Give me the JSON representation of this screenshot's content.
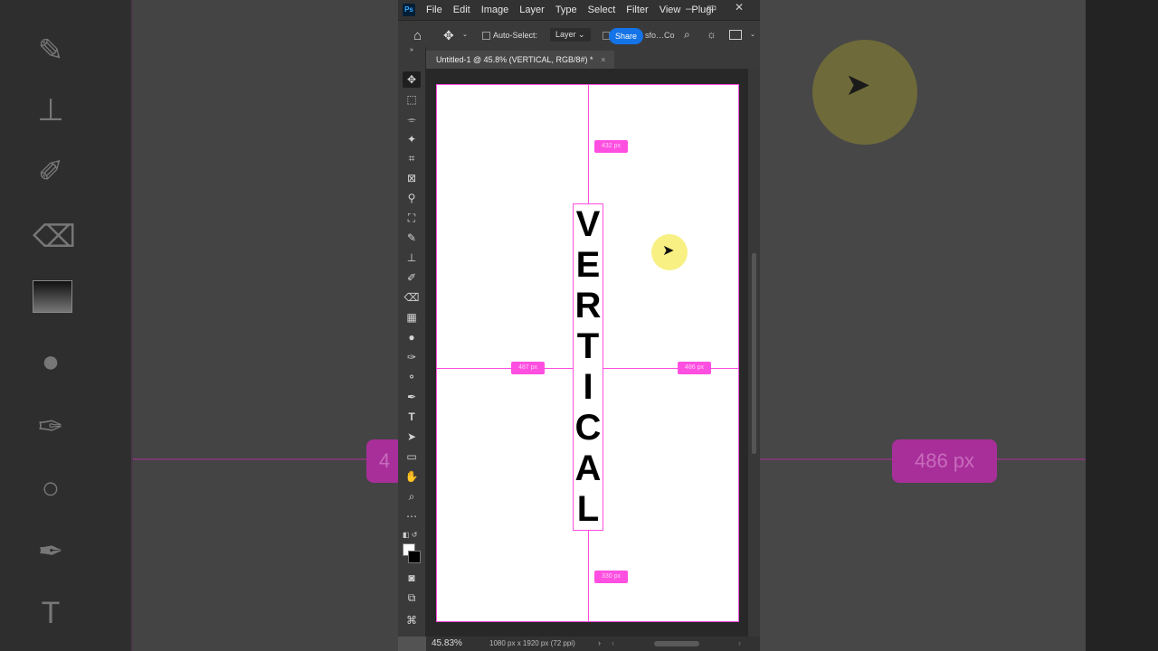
{
  "menubar": {
    "app_badge": "Ps",
    "items": [
      "File",
      "Edit",
      "Image",
      "Layer",
      "Type",
      "Select",
      "Filter",
      "View",
      "Plugi"
    ],
    "minimize": "–",
    "maximize": "▭",
    "close": "✕"
  },
  "options_bar": {
    "auto_select_label": "Auto-Select:",
    "auto_select_target": "Layer",
    "share_label": "Share",
    "account_fragment": "sfo…Co"
  },
  "document_tab": {
    "title": "Untitled-1 @ 45.8% (VERTICAL, RGB/8#) *",
    "close": "×"
  },
  "canvas": {
    "letters": [
      "V",
      "E",
      "R",
      "T",
      "I",
      "C",
      "A",
      "L"
    ],
    "measure_top": "432 px",
    "measure_left": "487 px",
    "measure_right": "486 px",
    "measure_bottom": "330 px",
    "guide_color": "#ff4fe1"
  },
  "status_bar": {
    "zoom": "45.83%",
    "doc_info": "1080 px x 1920 px (72 ppi)"
  },
  "backdrop": {
    "right_badge": "486 px",
    "left_badge": "4"
  },
  "colors": {
    "accent": "#1473e6",
    "guide": "#ff4fe1",
    "panel": "#3a3a3a",
    "menubar": "#323232"
  }
}
